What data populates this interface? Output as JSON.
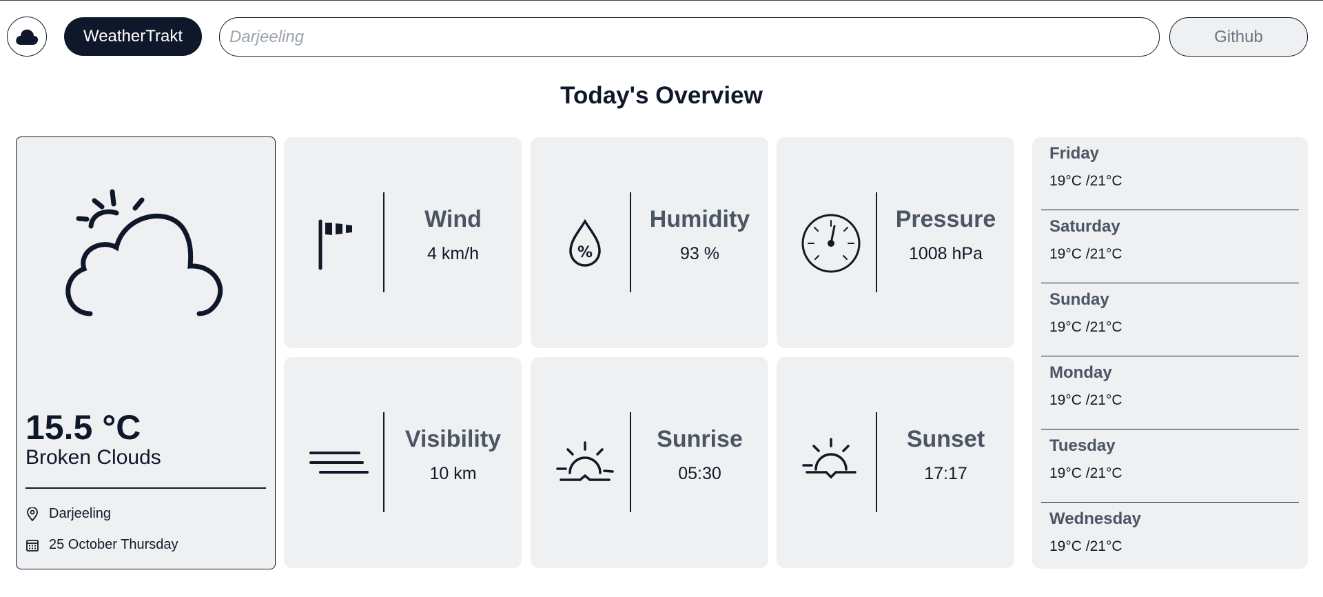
{
  "app": {
    "brand": "WeatherTrakt",
    "github_label": "Github"
  },
  "search": {
    "placeholder": "Darjeeling",
    "value": ""
  },
  "overview": {
    "title": "Today's Overview"
  },
  "current": {
    "temperature": "15.5 °C",
    "condition": "Broken Clouds",
    "location": "Darjeeling",
    "date": "25 October Thursday",
    "icon": "partly-cloudy-icon"
  },
  "stats": [
    {
      "label": "Wind",
      "value": "4 km/h",
      "icon": "windsock-icon"
    },
    {
      "label": "Humidity",
      "value": "93 %",
      "icon": "humidity-drop-icon"
    },
    {
      "label": "Pressure",
      "value": "1008 hPa",
      "icon": "pressure-gauge-icon"
    },
    {
      "label": "Visibility",
      "value": "10 km",
      "icon": "haze-lines-icon"
    },
    {
      "label": "Sunrise",
      "value": "05:30",
      "icon": "sunrise-icon"
    },
    {
      "label": "Sunset",
      "value": "17:17",
      "icon": "sunset-icon"
    }
  ],
  "forecast": [
    {
      "day": "Friday",
      "temps": "19°C /21°C"
    },
    {
      "day": "Saturday",
      "temps": "19°C /21°C"
    },
    {
      "day": "Sunday",
      "temps": "19°C /21°C"
    },
    {
      "day": "Monday",
      "temps": "19°C /21°C"
    },
    {
      "day": "Tuesday",
      "temps": "19°C /21°C"
    },
    {
      "day": "Wednesday",
      "temps": "19°C /21°C"
    }
  ],
  "colors": {
    "dark": "#0f172a",
    "card_bg": "#eef0f2",
    "label_gray": "#4b5563"
  }
}
